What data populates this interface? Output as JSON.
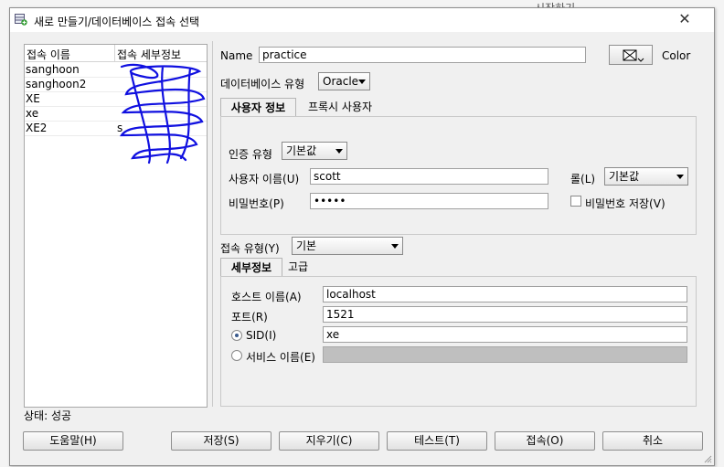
{
  "background": {
    "partial_text": "시작하기"
  },
  "dialog": {
    "title": "새로 만들기/데이터베이스 접속 선택",
    "close_glyph": "✕"
  },
  "connections": {
    "headers": [
      "접속 이름",
      "접속 세부정보"
    ],
    "rows": [
      {
        "name": "sanghoon",
        "detail": ""
      },
      {
        "name": "sanghoon2",
        "detail": ""
      },
      {
        "name": "XE",
        "detail": ""
      },
      {
        "name": "xe",
        "detail": ""
      },
      {
        "name": "XE2",
        "detail": "s"
      }
    ]
  },
  "form": {
    "name_label": "Name",
    "name_value": "practice",
    "color_label": "Color",
    "db_type_label": "데이터베이스 유형",
    "db_type_value": "Oracle",
    "tabs": [
      {
        "label": "사용자 정보",
        "active": true
      },
      {
        "label": "프록시 사용자",
        "active": false
      }
    ],
    "auth_type_label": "인증 유형",
    "auth_type_value": "기본값",
    "username_label": "사용자 이름(U)",
    "username_value": "scott",
    "role_label": "롤(L)",
    "role_value": "기본값",
    "password_label": "비밀번호(P)",
    "password_value": "•••••",
    "save_password_label": "비밀번호 저장(V)",
    "conn_type_label": "접속 유형(Y)",
    "conn_type_value": "기본",
    "sub_tabs": [
      {
        "label": "세부정보",
        "active": true
      },
      {
        "label": "고급",
        "active": false
      }
    ],
    "hostname_label": "호스트 이름(A)",
    "hostname_value": "localhost",
    "port_label": "포트(R)",
    "port_value": "1521",
    "sid_label": "SID(I)",
    "sid_value": "xe",
    "service_label": "서비스 이름(E)",
    "service_value": ""
  },
  "status": "상태: 성공",
  "buttons": {
    "help": "도움말(H)",
    "save": "저장(S)",
    "clear": "지우기(C)",
    "test": "테스트(T)",
    "connect": "접속(O)",
    "cancel": "취소"
  },
  "colors": {
    "scribble": "#1010e0",
    "window_bg": "#f0f0f0"
  }
}
